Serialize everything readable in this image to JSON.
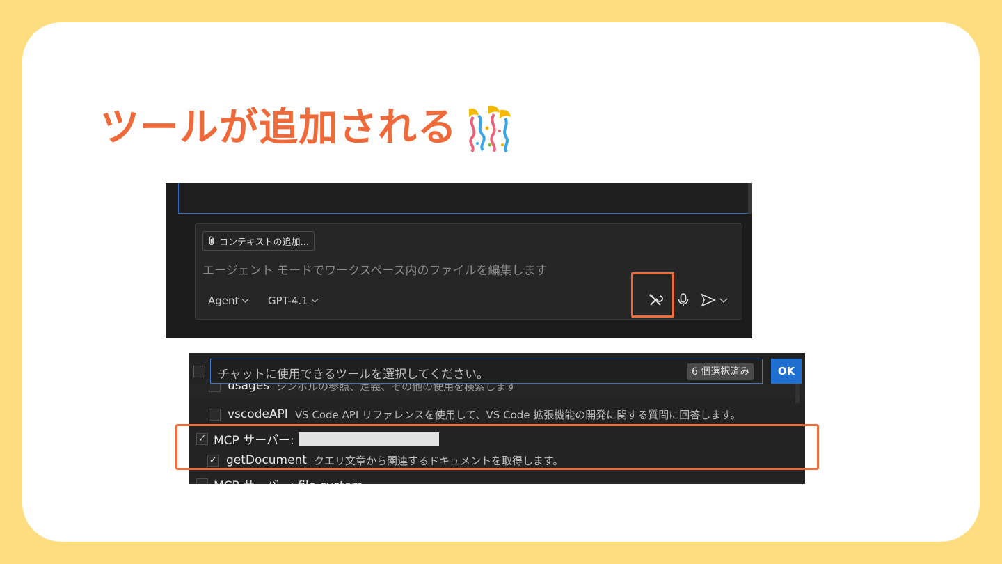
{
  "slide": {
    "title": "ツールが追加される",
    "emoji_icon": "confetti-streamers-icon",
    "background_color": "#fedd80",
    "accent_color": "#ef6a3a"
  },
  "chat_input": {
    "context_chip_label": "コンテキストの追加...",
    "context_chip_icon": "paperclip-icon",
    "placeholder": "エージェント モードでワークスペース内のファイルを編集します",
    "mode_picker": "Agent",
    "model_picker": "GPT-4.1",
    "icons": [
      "tools-icon",
      "microphone-icon",
      "send-icon",
      "chevron-down-icon"
    ]
  },
  "tool_picker": {
    "search_placeholder": "チャットに使用できるツールを選択してください。",
    "selected_count_badge": "6 個選択済み",
    "ok_label": "OK",
    "items": [
      {
        "name": "usages",
        "description": "シンボルの参照、定義、その他の使用を検索します",
        "checked": false,
        "indented": true
      },
      {
        "name": "vscodeAPI",
        "description": "VS Code API リファレンスを使用して、VS Code 拡張機能の開発に関する質問に回答します。",
        "checked": false,
        "indented": true
      },
      {
        "name": "MCP サーバー:",
        "description": "",
        "checked": true,
        "indented": false,
        "redacted": true
      },
      {
        "name": "getDocument",
        "description": "クエリ文章から関連するドキュメントを取得します。",
        "checked": true,
        "indented": true
      },
      {
        "name": "MCP サーバー: file-system",
        "description": "",
        "checked": false,
        "indented": false
      }
    ]
  }
}
